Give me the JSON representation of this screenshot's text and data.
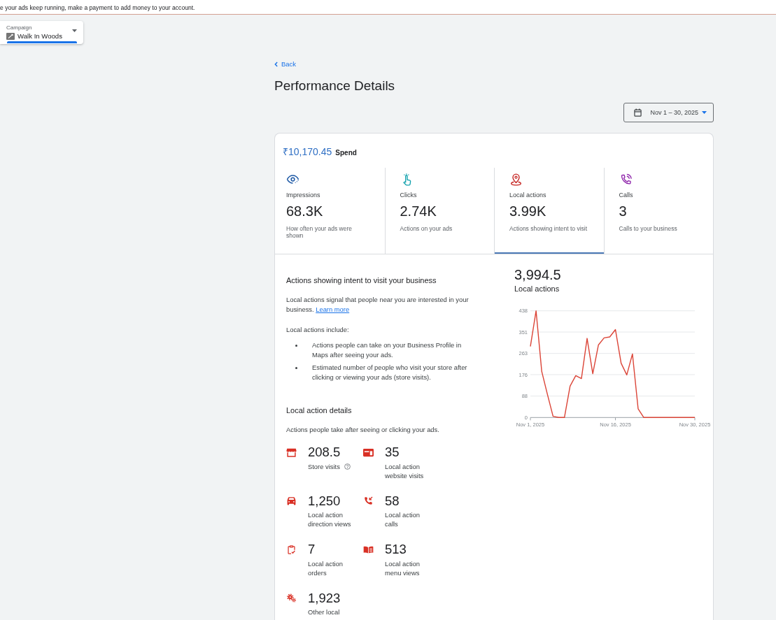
{
  "banner": {
    "message": "e your ads keep running, make a payment to add money to your account."
  },
  "campaign_selector": {
    "label": "Campaign",
    "value": "Walk In Woods"
  },
  "back_link": {
    "label": "Back"
  },
  "title": "Performance Details",
  "date_range": {
    "label": "Nov 1 – 30, 2025"
  },
  "summary": {
    "spend": {
      "amount": "₹10,170.45",
      "label": "Spend"
    },
    "metrics": [
      {
        "label": "Impressions",
        "value": "68.3K",
        "description": "How often your ads were shown",
        "selected": false
      },
      {
        "label": "Clicks",
        "value": "2.74K",
        "description": "Actions on your ads",
        "selected": false
      },
      {
        "label": "Local actions",
        "value": "3.99K",
        "description": "Actions showing intent to visit",
        "selected": true
      },
      {
        "label": "Calls",
        "value": "3",
        "description": "Calls to your business",
        "selected": false
      }
    ]
  },
  "intent": {
    "heading": "Actions showing intent to visit your business",
    "text": "Local actions signal that people near you are interested in your business.",
    "link": "Learn more",
    "includes_label": "Local actions include:",
    "includes": [
      "Actions people can take on your Business Profile in Maps after seeing your ads.",
      "Estimated number of people who visit your store after clicking or viewing your ads (store visits)."
    ]
  },
  "details": {
    "heading": "Local action details",
    "subtitle": "Actions people take after seeing or clicking your ads.",
    "items": [
      {
        "value": "208.5",
        "label": "Store visits",
        "help": true
      },
      {
        "value": "35",
        "label": "Local action website visits",
        "help": false
      },
      {
        "value": "1,250",
        "label": "Local action direction views",
        "help": false
      },
      {
        "value": "58",
        "label": "Local action calls",
        "help": false
      },
      {
        "value": "7",
        "label": "Local action orders",
        "help": false
      },
      {
        "value": "513",
        "label": "Local action menu views",
        "help": false
      },
      {
        "value": "1,923",
        "label": "Other local",
        "help": false
      }
    ]
  },
  "chart": {
    "total": "3,994.5",
    "chart_data": {
      "type": "line",
      "grid": true,
      "categories": [
        "Nov 1, 2025",
        null,
        null,
        null,
        null,
        null,
        null,
        null,
        null,
        null,
        null,
        null,
        null,
        null,
        null,
        "Nov 16, 2025",
        null,
        null,
        null,
        null,
        null,
        null,
        null,
        null,
        null,
        null,
        null,
        null,
        null,
        "Nov 30, 2025"
      ],
      "series": [
        {
          "name": "Local actions",
          "color": "#db4437",
          "values": [
            292,
            438,
            189,
            95,
            5,
            0,
            0,
            129,
            172,
            160,
            325,
            180,
            298,
            327,
            331,
            361,
            223,
            175,
            261,
            36,
            0,
            0,
            0,
            0,
            0,
            0,
            0,
            0,
            0,
            0
          ]
        }
      ],
      "ylim": [
        0,
        438
      ],
      "yticks": [
        0,
        88,
        176,
        263,
        351,
        438
      ]
    }
  }
}
